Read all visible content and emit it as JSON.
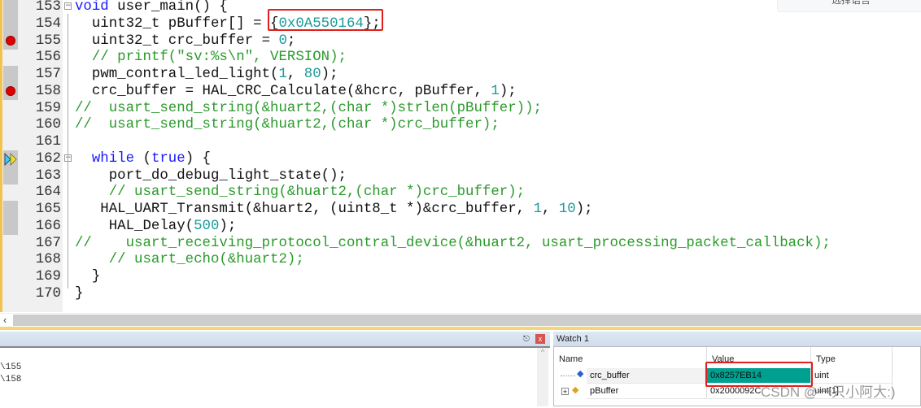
{
  "top_right_button": "选择语言",
  "code": {
    "lines": [
      {
        "num": "153",
        "bp": "grey",
        "fold": "minus",
        "tokens": [
          [
            "void",
            "k"
          ],
          [
            " user_main() {",
            "p"
          ]
        ]
      },
      {
        "num": "154",
        "bp": "grey",
        "tokens": [
          [
            "  uint32_t pBuffer[] = ",
            "p"
          ],
          [
            "{",
            "p"
          ],
          [
            "0x0A550164",
            "n"
          ],
          [
            "};",
            "p"
          ]
        ]
      },
      {
        "num": "155",
        "bp": "breakpoint",
        "tokens": [
          [
            "  uint32_t crc_buffer = ",
            "p"
          ],
          [
            "0",
            "n"
          ],
          [
            ";",
            "p"
          ]
        ]
      },
      {
        "num": "156",
        "bp": "",
        "tokens": [
          [
            "  // printf(\"sv:%s\\n\", VERSION);",
            "c"
          ]
        ]
      },
      {
        "num": "157",
        "bp": "grey",
        "tokens": [
          [
            "  pwm_contral_led_light(",
            "p"
          ],
          [
            "1",
            "n"
          ],
          [
            ", ",
            "p"
          ],
          [
            "80",
            "n"
          ],
          [
            ");",
            "p"
          ]
        ]
      },
      {
        "num": "158",
        "bp": "breakpoint",
        "tokens": [
          [
            "  crc_buffer = HAL_CRC_Calculate(&hcrc, pBuffer, ",
            "p"
          ],
          [
            "1",
            "n"
          ],
          [
            ");",
            "p"
          ]
        ]
      },
      {
        "num": "159",
        "bp": "",
        "tokens": [
          [
            "//  usart_send_string(&huart2,(char *)strlen(pBuffer));",
            "c"
          ]
        ]
      },
      {
        "num": "160",
        "bp": "",
        "tokens": [
          [
            "//  usart_send_string(&huart2,(char *)crc_buffer);",
            "c"
          ]
        ]
      },
      {
        "num": "161",
        "bp": "",
        "tokens": []
      },
      {
        "num": "162",
        "bp": "current",
        "fold": "minus",
        "tokens": [
          [
            "  ",
            "p"
          ],
          [
            "while",
            "k"
          ],
          [
            " (",
            "p"
          ],
          [
            "true",
            "k"
          ],
          [
            ") {",
            "p"
          ]
        ]
      },
      {
        "num": "163",
        "bp": "grey",
        "tokens": [
          [
            "    port_do_debug_light_state();",
            "p"
          ]
        ]
      },
      {
        "num": "164",
        "bp": "",
        "tokens": [
          [
            "    // usart_send_string(&huart2,(char *)crc_buffer);",
            "c"
          ]
        ]
      },
      {
        "num": "165",
        "bp": "grey",
        "tokens": [
          [
            "   HAL_UART_Transmit(&huart2, (uint8_t *)&crc_buffer, ",
            "p"
          ],
          [
            "1",
            "n"
          ],
          [
            ", ",
            "p"
          ],
          [
            "10",
            "n"
          ],
          [
            ");",
            "p"
          ]
        ]
      },
      {
        "num": "166",
        "bp": "grey",
        "tokens": [
          [
            "    HAL_Delay(",
            "p"
          ],
          [
            "500",
            "n"
          ],
          [
            ");",
            "p"
          ]
        ]
      },
      {
        "num": "167",
        "bp": "",
        "tokens": [
          [
            "//    usart_receiving_protocol_contral_device(&huart2, usart_processing_packet_callback);",
            "c"
          ]
        ]
      },
      {
        "num": "168",
        "bp": "",
        "tokens": [
          [
            "    // usart_echo(&huart2);",
            "c"
          ]
        ]
      },
      {
        "num": "169",
        "bp": "",
        "tokens": [
          [
            "  }",
            "p"
          ]
        ]
      },
      {
        "num": "170",
        "bp": "",
        "tokens": [
          [
            "}",
            "p"
          ]
        ]
      }
    ]
  },
  "output_panel": {
    "lines": [
      "\\155",
      "\\158"
    ]
  },
  "watch": {
    "title": "Watch 1",
    "columns": [
      "Name",
      "Value",
      "Type"
    ],
    "rows": [
      {
        "name": "crc_buffer",
        "value": "0x8257EB14",
        "type": "uint",
        "highlighted": true
      },
      {
        "name": "pBuffer",
        "value": "0x2000092C",
        "type": "uint[1]",
        "expandable": true
      }
    ]
  },
  "watermark": "CSDN @一只小阿大:)",
  "colors": {
    "keyword": "#1a1aff",
    "number": "#1a9a9a",
    "comment": "#2b9a2b",
    "highlight_box": "#e0201c",
    "value_highlight": "#00a090"
  }
}
